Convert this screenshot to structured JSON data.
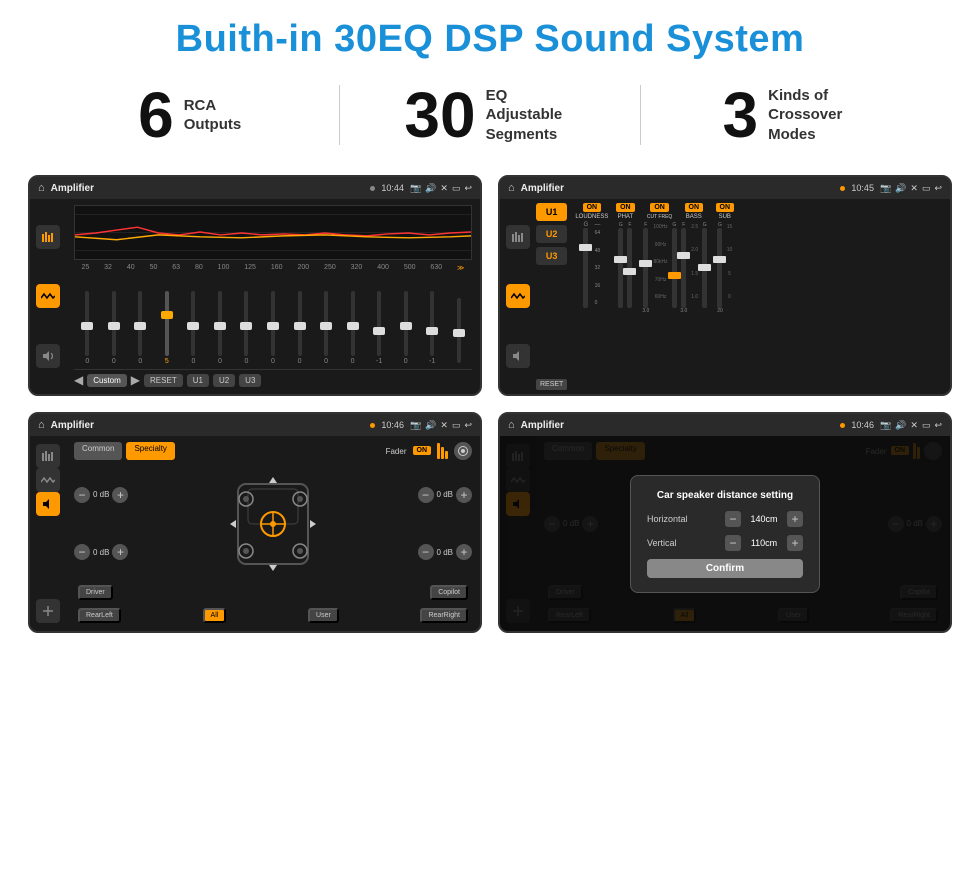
{
  "header": {
    "title": "Buith-in 30EQ DSP Sound System"
  },
  "stats": [
    {
      "number": "6",
      "label": "RCA\nOutputs"
    },
    {
      "number": "30",
      "label": "EQ Adjustable\nSegments"
    },
    {
      "number": "3",
      "label": "Kinds of\nCrossover Modes"
    }
  ],
  "screens": [
    {
      "id": "screen1",
      "topbar": {
        "time": "10:44",
        "title": "Amplifier"
      },
      "type": "eq",
      "eq_freqs": [
        "25",
        "32",
        "40",
        "50",
        "63",
        "80",
        "100",
        "125",
        "160",
        "200",
        "250",
        "320",
        "400",
        "500",
        "630"
      ],
      "eq_values": [
        "0",
        "0",
        "0",
        "5",
        "0",
        "0",
        "0",
        "0",
        "0",
        "0",
        "0",
        "-1",
        "0",
        "-1",
        ""
      ],
      "buttons": [
        "Custom",
        "RESET",
        "U1",
        "U2",
        "U3"
      ]
    },
    {
      "id": "screen2",
      "topbar": {
        "time": "10:45",
        "title": "Amplifier"
      },
      "type": "crossover",
      "presets": [
        "U1",
        "U2",
        "U3"
      ],
      "channels": [
        {
          "label": "LOUDNESS",
          "on": true,
          "values": [
            "64",
            "48",
            "32",
            "16",
            "0"
          ]
        },
        {
          "label": "PHAT",
          "on": true,
          "values": [
            "G",
            "F"
          ]
        },
        {
          "label": "CUT FREQ",
          "on": true
        },
        {
          "label": "BASS",
          "on": true
        },
        {
          "label": "SUB",
          "on": true
        }
      ],
      "reset_label": "RESET"
    },
    {
      "id": "screen3",
      "topbar": {
        "time": "10:46",
        "title": "Amplifier"
      },
      "type": "fader",
      "tabs": [
        "Common",
        "Specialty"
      ],
      "active_tab": "Specialty",
      "fader_label": "Fader",
      "fader_on": true,
      "db_controls": [
        {
          "label": "",
          "value": "0 dB"
        },
        {
          "label": "",
          "value": "0 dB"
        },
        {
          "label": "",
          "value": "0 dB"
        },
        {
          "label": "",
          "value": "0 dB"
        }
      ],
      "position_buttons": [
        "Driver",
        "",
        "Copilot",
        "RearLeft",
        "All",
        "",
        "User",
        "RearRight"
      ]
    },
    {
      "id": "screen4",
      "topbar": {
        "time": "10:46",
        "title": "Amplifier"
      },
      "type": "fader_dialog",
      "tabs": [
        "Common",
        "Specialty"
      ],
      "dialog": {
        "title": "Car speaker distance setting",
        "params": [
          {
            "label": "Horizontal",
            "value": "140cm"
          },
          {
            "label": "Vertical",
            "value": "110cm"
          }
        ],
        "confirm_label": "Confirm"
      },
      "db_controls": [
        {
          "value": "0 dB"
        },
        {
          "value": "0 dB"
        }
      ],
      "position_buttons": [
        "Driver",
        "Copilot",
        "RearLeft",
        "All",
        "User",
        "RearRight"
      ]
    }
  ]
}
